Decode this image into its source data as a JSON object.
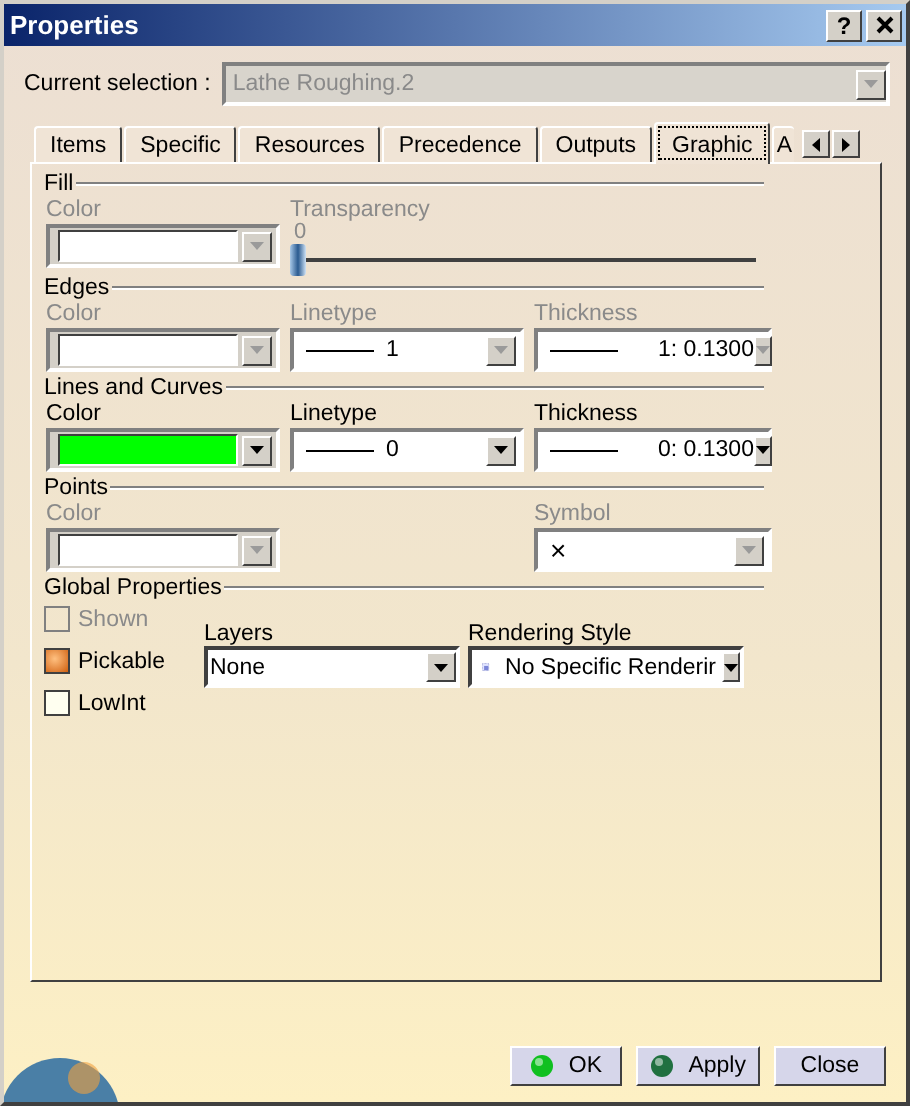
{
  "window": {
    "title": "Properties",
    "help": "?"
  },
  "current_selection": {
    "label": "Current selection :",
    "value": "Lathe Roughing.2",
    "disabled": true
  },
  "tabs": [
    {
      "label": "Items",
      "selected": false
    },
    {
      "label": "Specific",
      "selected": false
    },
    {
      "label": "Resources",
      "selected": false
    },
    {
      "label": "Precedence",
      "selected": false
    },
    {
      "label": "Outputs",
      "selected": false
    },
    {
      "label": "Graphic",
      "selected": true
    },
    {
      "label": "A",
      "selected": false
    }
  ],
  "sections": [
    {
      "title": "Fill",
      "fields": [
        {
          "kind": "color",
          "label": "Color",
          "disabled": true,
          "color": "#ffffff"
        },
        {
          "kind": "slider",
          "label": "Transparency",
          "disabled": true,
          "reading": "0",
          "level": 0
        }
      ]
    },
    {
      "title": "Edges",
      "fields": [
        {
          "kind": "color",
          "label": "Color",
          "disabled": true,
          "color": "#ffffff"
        },
        {
          "kind": "line",
          "label": "Linetype",
          "disabled": true,
          "value": "1"
        },
        {
          "kind": "line",
          "label": "Thickness",
          "disabled": true,
          "value": "1: 0.1300"
        }
      ]
    },
    {
      "title": "Lines and Curves",
      "fields": [
        {
          "kind": "color",
          "label": "Color",
          "disabled": false,
          "color": "#00ff00"
        },
        {
          "kind": "line",
          "label": "Linetype",
          "disabled": false,
          "value": "0"
        },
        {
          "kind": "line",
          "label": "Thickness",
          "disabled": false,
          "value": "0: 0.1300"
        }
      ]
    },
    {
      "title": "Points",
      "fields": [
        {
          "kind": "color",
          "label": "Color",
          "disabled": true,
          "color": "#ffffff"
        },
        {
          "kind": "symbol",
          "label": "Symbol",
          "disabled": true,
          "value": "×"
        }
      ]
    }
  ],
  "global_properties": {
    "title": "Global Properties",
    "checkboxes": [
      {
        "label": "Shown",
        "checked": false,
        "disabled": true
      },
      {
        "label": "Pickable",
        "checked": true,
        "disabled": false
      },
      {
        "label": "LowInt",
        "checked": false,
        "disabled": false
      }
    ],
    "layers": {
      "label": "Layers",
      "value": "None"
    },
    "rendering_style": {
      "label": "Rendering Style",
      "value": "No Specific Renderir"
    }
  },
  "buttons": [
    {
      "label": "OK",
      "kind": "ok"
    },
    {
      "label": "Apply",
      "kind": "apply"
    },
    {
      "label": "Close",
      "kind": "plain"
    }
  ]
}
